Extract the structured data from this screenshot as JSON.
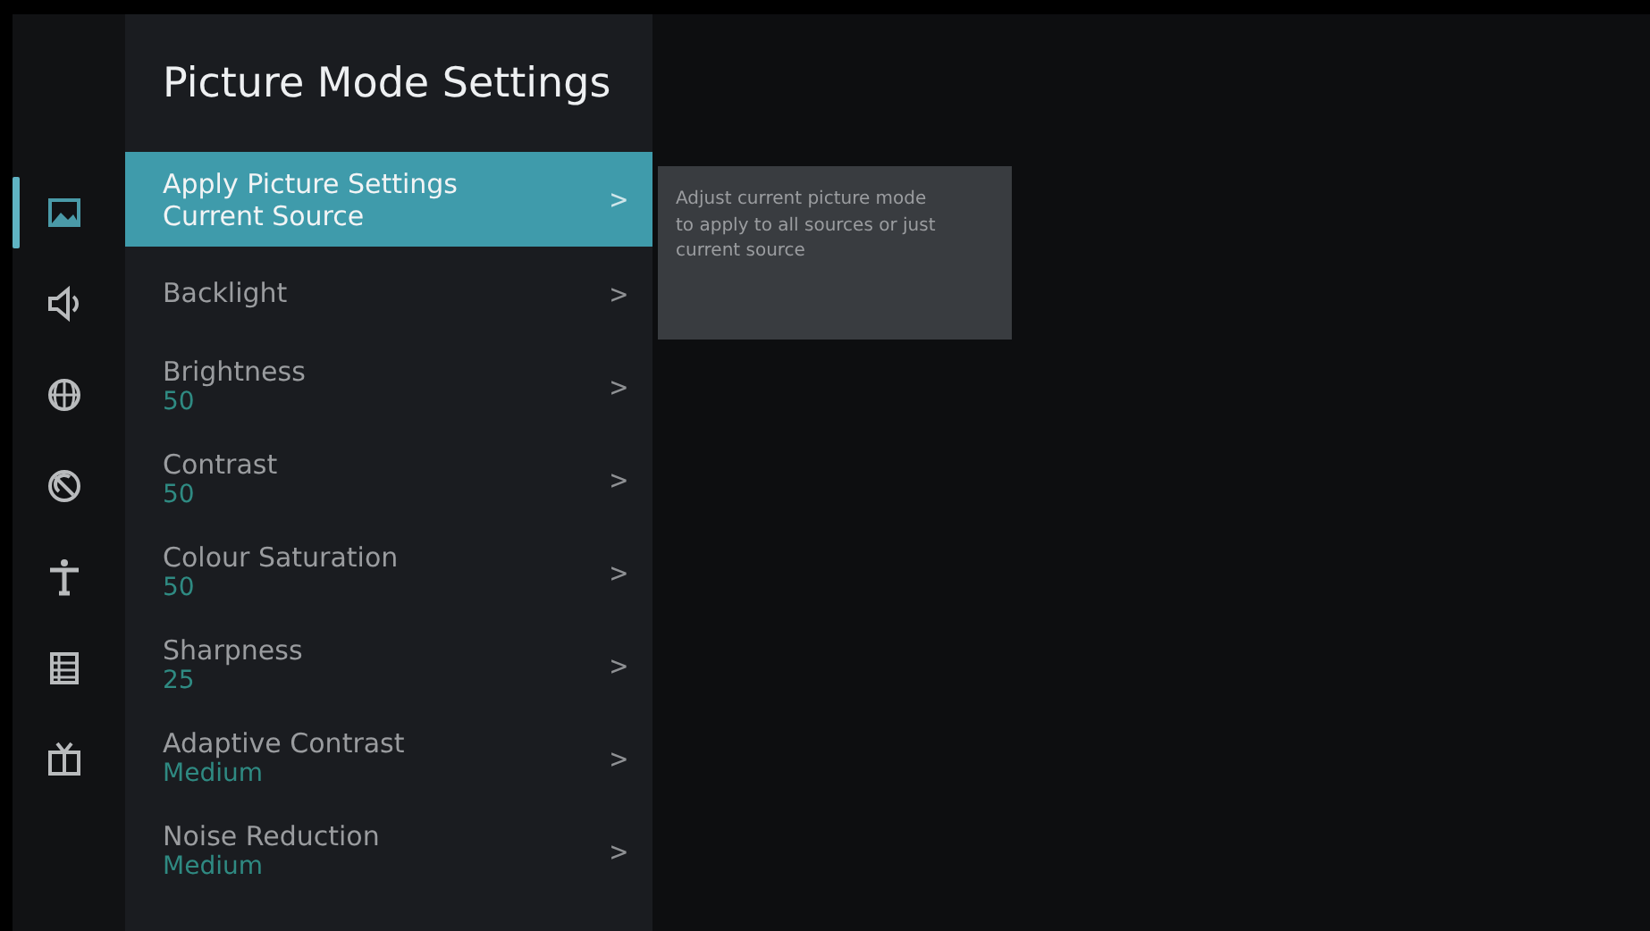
{
  "sidebar": {
    "items": [
      {
        "kind": "picture",
        "selected": true
      },
      {
        "kind": "sound",
        "selected": false
      },
      {
        "kind": "globe",
        "selected": false
      },
      {
        "kind": "dish",
        "selected": false
      },
      {
        "kind": "figure",
        "selected": false
      },
      {
        "kind": "list",
        "selected": false
      },
      {
        "kind": "tv",
        "selected": false
      }
    ]
  },
  "menu": {
    "title": "Picture Mode Settings",
    "items": [
      {
        "label": "Apply Picture Settings",
        "value": "Current Source",
        "selected": true
      },
      {
        "label": "Backlight",
        "selected": false
      },
      {
        "label": "Brightness",
        "value": "50",
        "selected": false
      },
      {
        "label": "Contrast",
        "value": "50",
        "selected": false
      },
      {
        "label": "Colour Saturation",
        "value": "50",
        "selected": false
      },
      {
        "label": "Sharpness",
        "value": "25",
        "selected": false
      },
      {
        "label": "Adaptive Contrast",
        "value": "Medium",
        "selected": false
      },
      {
        "label": "Noise Reduction",
        "value": "Medium",
        "selected": false
      }
    ],
    "chevron": ">"
  },
  "tooltip": {
    "text": "Adjust current picture mode to apply to all sources or just current source"
  }
}
